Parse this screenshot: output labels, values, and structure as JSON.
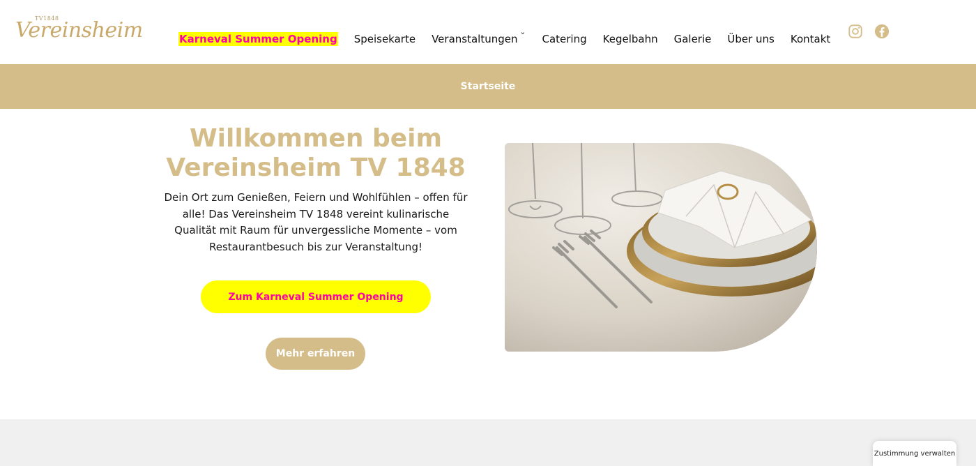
{
  "logo": {
    "small": "TV1848",
    "name": "Vereinsheim"
  },
  "nav": {
    "items": [
      {
        "label": "Karneval Summer Opening"
      },
      {
        "label": "Speisekarte"
      },
      {
        "label": "Veranstaltungen"
      },
      {
        "label": "Catering"
      },
      {
        "label": "Kegelbahn"
      },
      {
        "label": "Galerie"
      },
      {
        "label": "Über uns"
      },
      {
        "label": "Kontakt"
      }
    ]
  },
  "breadcrumb": {
    "current": "Startseite"
  },
  "hero": {
    "title": "Willkommen beim Vereinsheim TV 1848",
    "text": "Dein Ort zum Genießen, Feiern und Wohlfühlen – offen für alle! Das Vereinsheim TV 1848 vereint kulinarische Qualität mit Raum für unvergessliche Momente – vom Restaurantbesuch bis zur Veranstaltung!",
    "primary_button": "Zum Karneval Summer Opening",
    "secondary_button": "Mehr erfahren"
  },
  "consent": {
    "label": "Zustimmung verwalten"
  },
  "colors": {
    "accent": "#d4bd89",
    "highlight": "#ffff00",
    "highlight_text": "#ff00aa"
  }
}
